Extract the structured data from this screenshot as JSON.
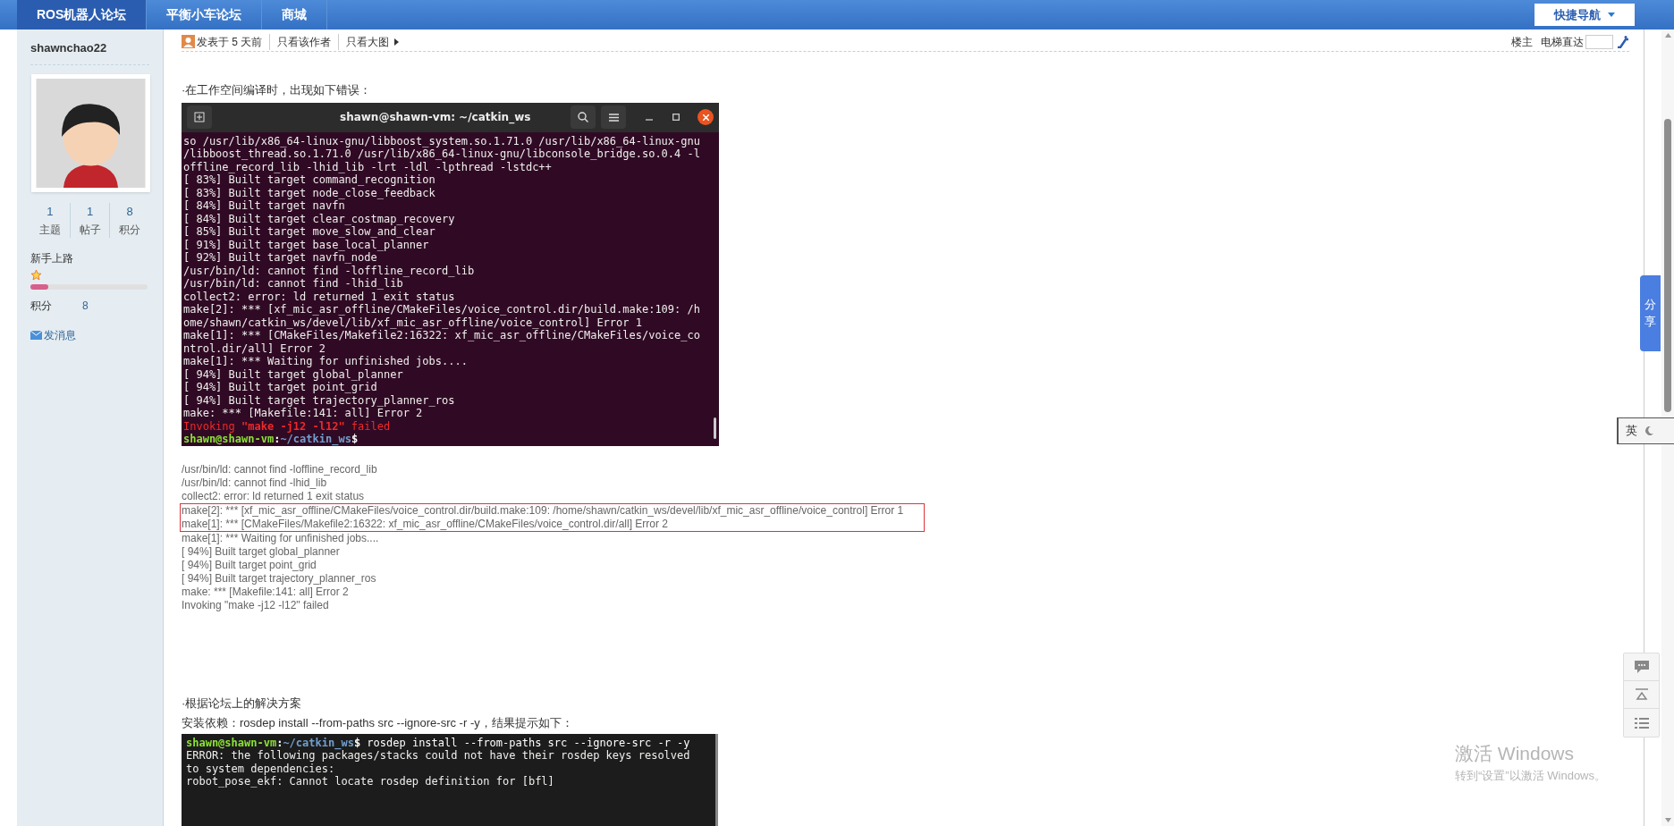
{
  "nav": {
    "tabs": [
      {
        "label": "ROS机器人论坛",
        "selected": true
      },
      {
        "label": "平衡小车论坛",
        "selected": false
      },
      {
        "label": "商城",
        "selected": false
      }
    ],
    "quick_nav": "快捷导航"
  },
  "author": {
    "name": "shawnchao22",
    "stats": [
      {
        "value": "1",
        "label": "主题"
      },
      {
        "value": "1",
        "label": "帖子"
      },
      {
        "value": "8",
        "label": "积分"
      }
    ],
    "rank": "新手上路",
    "level": 0.15,
    "points_label": "积分",
    "points": "8",
    "message": "发消息"
  },
  "post": {
    "posted": "发表于 5 天前",
    "links": [
      "只看该作者",
      "只看大图"
    ],
    "floor": "楼主",
    "jump_label": "电梯直达",
    "intro": "·在工作空间编译时，出现如下错误：",
    "terminal": {
      "title": "shawn@shawn-vm: ~/catkin_ws",
      "lines": [
        {
          "kind": "text",
          "text": "so /usr/lib/x86_64-linux-gnu/libboost_system.so.1.71.0 /usr/lib/x86_64-linux-gnu"
        },
        {
          "kind": "text",
          "text": "/libboost_thread.so.1.71.0 /usr/lib/x86_64-linux-gnu/libconsole_bridge.so.0.4 -l"
        },
        {
          "kind": "text",
          "text": "offline_record_lib -lhid_lib -lrt -ldl -lpthread -lstdc++"
        },
        {
          "kind": "text",
          "text": "[ 83%] Built target command_recognition"
        },
        {
          "kind": "text",
          "text": "[ 83%] Built target node_close_feedback"
        },
        {
          "kind": "text",
          "text": "[ 84%] Built target navfn"
        },
        {
          "kind": "text",
          "text": "[ 84%] Built target clear_costmap_recovery"
        },
        {
          "kind": "text",
          "text": "[ 85%] Built target move_slow_and_clear"
        },
        {
          "kind": "text",
          "text": "[ 91%] Built target base_local_planner"
        },
        {
          "kind": "text",
          "text": "[ 92%] Built target navfn_node"
        },
        {
          "kind": "text",
          "text": "/usr/bin/ld: cannot find -loffline_record_lib"
        },
        {
          "kind": "text",
          "text": "/usr/bin/ld: cannot find -lhid_lib"
        },
        {
          "kind": "text",
          "text": "collect2: error: ld returned 1 exit status"
        },
        {
          "kind": "text",
          "text": "make[2]: *** [xf_mic_asr_offline/CMakeFiles/voice_control.dir/build.make:109: /h"
        },
        {
          "kind": "text",
          "text": "ome/shawn/catkin_ws/devel/lib/xf_mic_asr_offline/voice_control] Error 1"
        },
        {
          "kind": "text",
          "text": "make[1]: *** [CMakeFiles/Makefile2:16322: xf_mic_asr_offline/CMakeFiles/voice_co"
        },
        {
          "kind": "text",
          "text": "ntrol.dir/all] Error 2"
        },
        {
          "kind": "text",
          "text": "make[1]: *** Waiting for unfinished jobs...."
        },
        {
          "kind": "text",
          "text": "[ 94%] Built target global_planner"
        },
        {
          "kind": "text",
          "text": "[ 94%] Built target point_grid"
        },
        {
          "kind": "text",
          "text": "[ 94%] Built target trajectory_planner_ros"
        },
        {
          "kind": "text",
          "text": "make: *** [Makefile:141: all] Error 2"
        },
        {
          "kind": "error",
          "text": "Invoking **\"make -j12 -l12\"** failed"
        },
        {
          "kind": "prompt",
          "parts": [
            "shawn@shawn-vm",
            ":",
            "~/catkin_ws",
            "$"
          ]
        }
      ]
    },
    "log": [
      {
        "text": "/usr/bin/ld: cannot find -loffline_record_lib",
        "highlighted": false
      },
      {
        "text": "/usr/bin/ld: cannot find -lhid_lib",
        "highlighted": false
      },
      {
        "text": "collect2: error: ld returned 1 exit status",
        "highlighted": false
      },
      {
        "text": "make[2]: *** [xf_mic_asr_offline/CMakeFiles/voice_control.dir/build.make:109: /home/shawn/catkin_ws/devel/lib/xf_mic_asr_offline/voice_control] Error 1",
        "highlighted": true
      },
      {
        "text": "make[1]: *** [CMakeFiles/Makefile2:16322: xf_mic_asr_offline/CMakeFiles/voice_control.dir/all] Error 2",
        "highlighted": true
      },
      {
        "text": "make[1]: *** Waiting for unfinished jobs....",
        "highlighted": false
      },
      {
        "text": "[ 94%] Built target global_planner",
        "highlighted": false
      },
      {
        "text": "[ 94%] Built target point_grid",
        "highlighted": false
      },
      {
        "text": "[ 94%] Built target trajectory_planner_ros",
        "highlighted": false
      },
      {
        "text": "make: *** [Makefile:141: all] Error 2",
        "highlighted": false
      },
      {
        "text": "Invoking \"make -j12 -l12\" failed",
        "highlighted": false
      }
    ],
    "solution_heading": "·根据论坛上的解决方案",
    "install_text": "安装依赖：rosdep install --from-paths src --ignore-src -r -y，结果提示如下：",
    "terminal2": {
      "lines": [
        {
          "kind": "prompt",
          "parts": [
            "shawn@shawn-vm",
            ":",
            "~/catkin_ws",
            "$",
            " rosdep install --from-paths src --ignore-src -r -y"
          ]
        },
        {
          "kind": "text",
          "text": "ERROR: the following packages/stacks could not have their rosdep keys resolved"
        },
        {
          "kind": "text",
          "text": "to system dependencies:"
        },
        {
          "kind": "text",
          "text": "robot_pose_ekf: Cannot locate rosdep definition for [bfl]"
        }
      ]
    }
  },
  "share": "分享",
  "ime": "英",
  "windows": {
    "title": "激活 Windows",
    "hint": "转到“设置”以激活 Windows。"
  }
}
